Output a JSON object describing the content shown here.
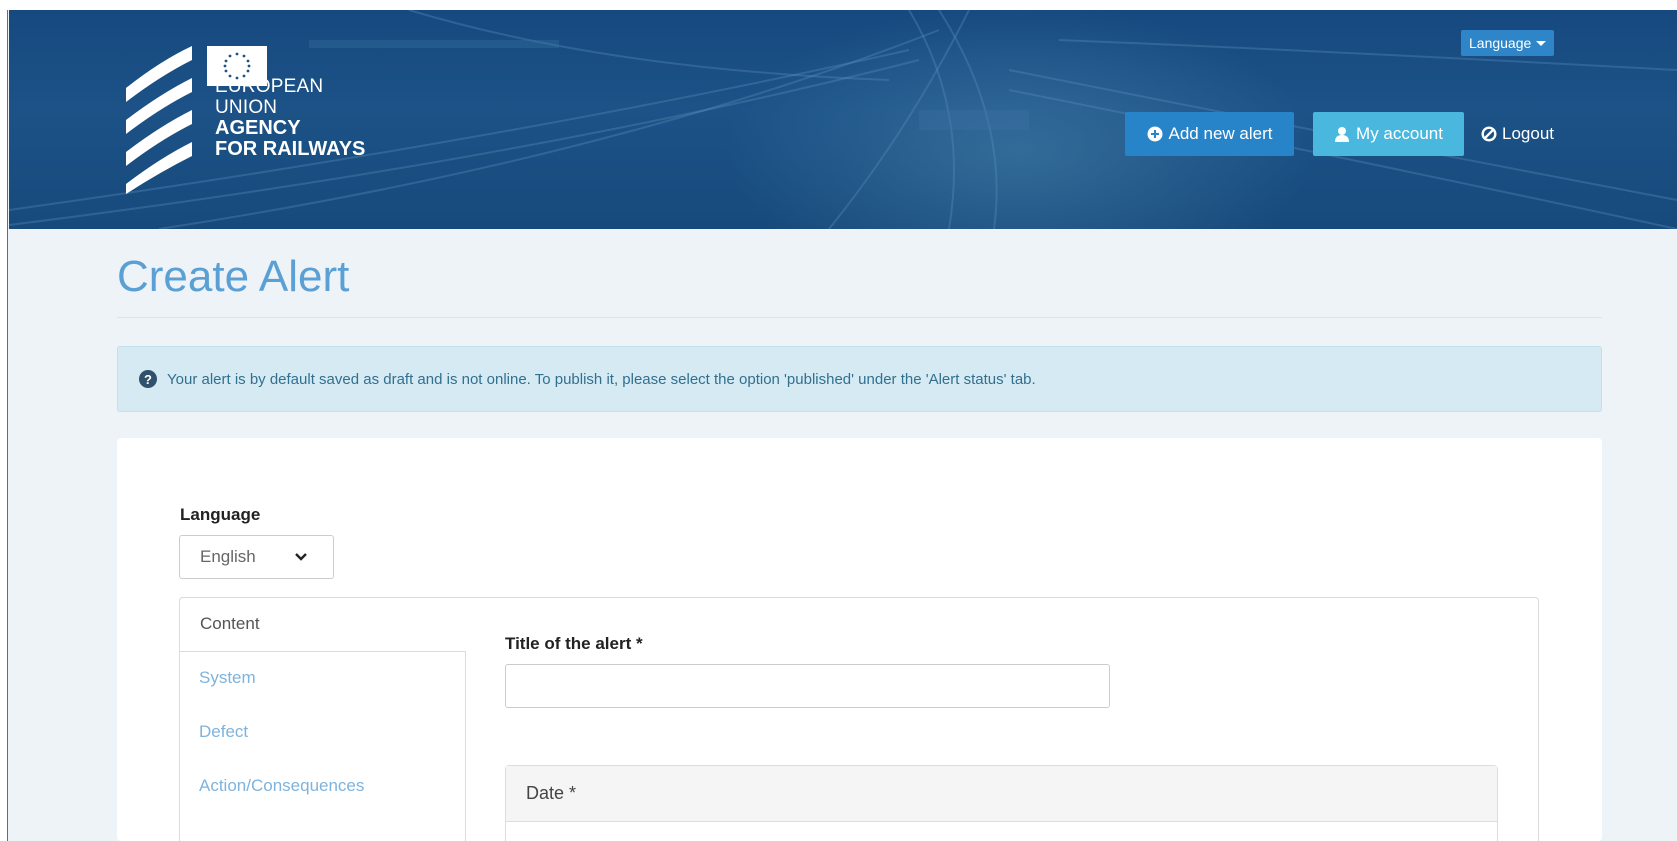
{
  "header": {
    "logo": {
      "line1": "EUROPEAN",
      "line2": "UNION",
      "line3": "AGENCY",
      "line4": "FOR RAILWAYS"
    },
    "language_button": "Language",
    "add_alert_button": "Add new alert",
    "my_account_button": "My account",
    "logout_link": "Logout"
  },
  "page": {
    "title": "Create Alert",
    "info_message": "Your alert is by default saved as draft and is not online. To publish it, please select the option 'published' under the 'Alert status' tab."
  },
  "form": {
    "language_label": "Language",
    "language_value": "English",
    "tabs": [
      {
        "label": "Content",
        "active": true
      },
      {
        "label": "System",
        "active": false
      },
      {
        "label": "Defect",
        "active": false
      },
      {
        "label": "Action/Consequences",
        "active": false
      }
    ],
    "title_label": "Title of the alert *",
    "title_value": "",
    "date_panel_heading": "Date *"
  },
  "colors": {
    "header_bg": "#1c5287",
    "primary_button": "#2784c8",
    "info_button": "#4ab8de",
    "page_title": "#5aa0d4",
    "tab_link": "#7fb3dc",
    "info_alert_bg": "#d6eaf3"
  }
}
